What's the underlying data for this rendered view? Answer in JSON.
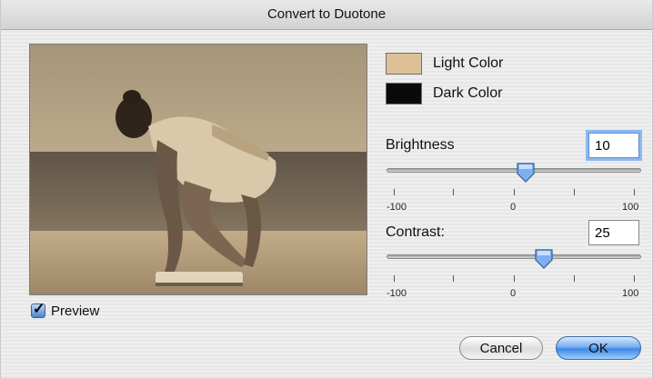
{
  "window": {
    "title": "Convert to Duotone"
  },
  "preview": {
    "label": "Preview",
    "checked": true
  },
  "colors": {
    "light": {
      "label": "Light Color",
      "value": "#dcc197"
    },
    "dark": {
      "label": "Dark Color",
      "value": "#0a0a0a"
    }
  },
  "brightness": {
    "label": "Brightness",
    "value": "10",
    "min_label": "-100",
    "mid_label": "0",
    "max_label": "100",
    "level": 10
  },
  "contrast": {
    "label": "Contrast:",
    "value": "25",
    "min_label": "-100",
    "mid_label": "0",
    "max_label": "100",
    "level": 25
  },
  "buttons": {
    "cancel": "Cancel",
    "ok": "OK"
  }
}
